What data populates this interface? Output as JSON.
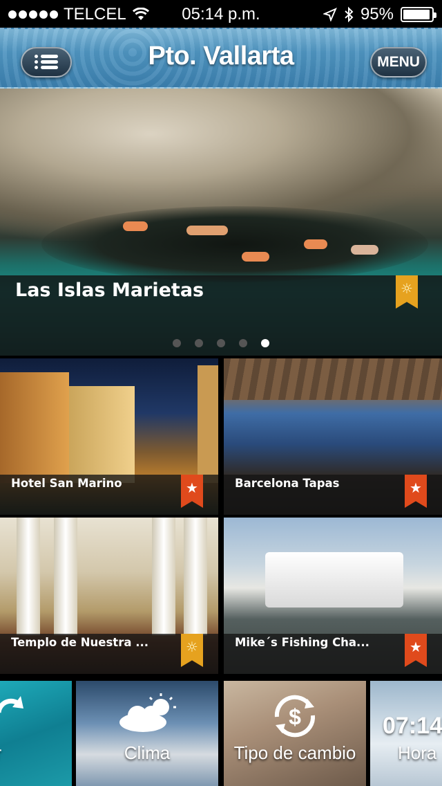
{
  "status_bar": {
    "carrier": "TELCEL",
    "time": "05:14 p.m.",
    "battery": "95%",
    "battery_level": 0.95,
    "signal_bars": 5
  },
  "nav": {
    "title": "Pto. Vallarta",
    "menu_label": "MENU",
    "list_icon": "list-icon"
  },
  "hero": {
    "title": "Las Islas Marietas",
    "badge": "sun-icon",
    "page_count": 5,
    "active_page": 5
  },
  "tiles": [
    {
      "title": "Hotel San Marino",
      "badge": "star-icon"
    },
    {
      "title": "Barcelona Tapas",
      "badge": "star-icon"
    },
    {
      "title": "Templo de Nuestra ...",
      "badge": "sun-icon"
    },
    {
      "title": "Mike´s Fishing Cha...",
      "badge": "star-icon"
    }
  ],
  "shortcuts": [
    {
      "label": "alizar",
      "icon": "refresh-icon"
    },
    {
      "label": "Clima",
      "icon": "weather-cloud-sun-icon"
    },
    {
      "label": "Tipo de cambio",
      "icon": "currency-exchange-icon"
    },
    {
      "label": "Hora",
      "icon": "clock-icon",
      "value": "07:14"
    }
  ],
  "colors": {
    "nav_blue": "#3b7fae",
    "sun_ribbon": "#e6a21f",
    "star_ribbon": "#e04a1c"
  }
}
